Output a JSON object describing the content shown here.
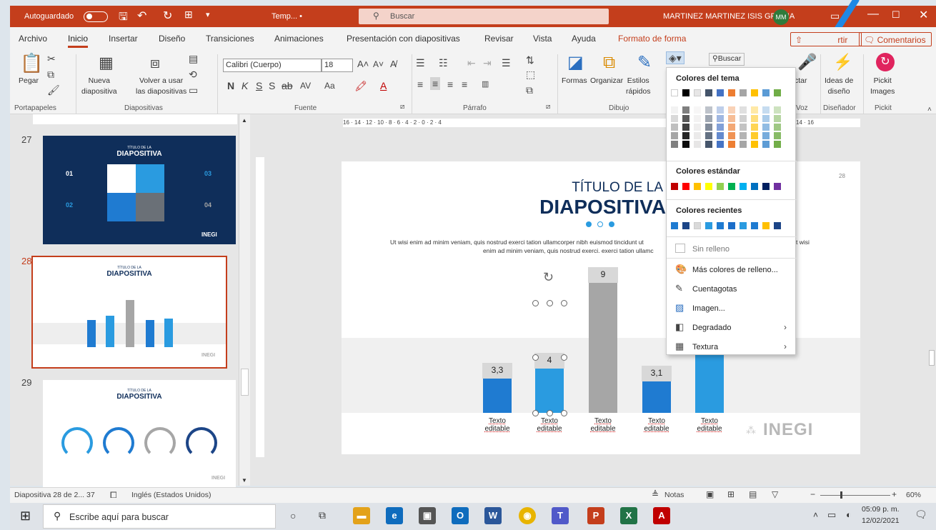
{
  "titlebar": {
    "autosave_label": "Autoguardado",
    "doc": "Temp... •",
    "search": "Buscar",
    "user": "MARTINEZ MARTINEZ ISIS GRECIA",
    "initials": "MM"
  },
  "menu": [
    "Archivo",
    "Inicio",
    "Insertar",
    "Diseño",
    "Transiciones",
    "Animaciones",
    "Presentación con diapositivas",
    "Revisar",
    "Vista",
    "Ayuda",
    "Formato de forma"
  ],
  "menu_right": {
    "comments": "Comentarios",
    "share": "rtir"
  },
  "ribbon": {
    "paste": "Pegar",
    "new_slide": "Nueva\ndiapositiva",
    "reuse": "Volver a usar\nlas diapositivas",
    "font_name": "Calibri (Cuerpo)",
    "font_size": "18",
    "bold": "N",
    "italic": "K",
    "underline": "S",
    "strike": "S",
    "shapes": "Formas",
    "arrange": "Organizar",
    "styles": "Estilos\nrápidos",
    "find": "Buscar",
    "dictate": "ctar",
    "design_ideas": "Ideas de\ndiseño",
    "pickit": "Pickit\nImages",
    "groups": {
      "clipboard": "Portapapeles",
      "slides": "Diapositivas",
      "font": "Fuente",
      "paragraph": "Párrafo",
      "drawing": "Dibujo",
      "voice": "Voz",
      "designer": "Diseñador",
      "pickit": "Pickit"
    }
  },
  "ruler_text": "16 · 14 · 12 · 10 · 8 · 6 · 4 · 2 · 0 · 2 · 4",
  "ruler_right": "14 · 16",
  "thumbnails": [
    {
      "num": "27",
      "title_small": "TÍTULO DE LA",
      "title": "DIAPOSITIVA",
      "n1": "01",
      "n2": "02",
      "n3": "03",
      "n4": "04",
      "logo": "INEGI"
    },
    {
      "num": "28",
      "title_small": "TÍTULO DE LA",
      "title": "DIAPOSITIVA",
      "logo": "INEGI"
    },
    {
      "num": "29",
      "title_small": "TÍTULO DE LA",
      "title": "DIAPOSITIVA",
      "logo": "INEGI"
    }
  ],
  "slide": {
    "page_num": "28",
    "title_small": "TÍTULO DE LA",
    "title": "DIAPOSITIVA",
    "body1": "Ut wisi enim ad minim veniam, quis nostrud exerci tation ullamcorper nibh euismod tincidunt ut",
    "body1b": "t wisi",
    "body2": "enim ad minim veniam, quis nostrud exerci. exerci tation ullamc",
    "logo": "INEGI",
    "bar_label": "Texto\neditable"
  },
  "chart_data": {
    "type": "bar",
    "categories": [
      "Texto editable",
      "Texto editable",
      "Texto editable",
      "Texto editable",
      "Texto editable"
    ],
    "values": [
      3.3,
      4,
      9,
      3.1,
      null
    ],
    "value_labels": [
      "3,3",
      "4",
      "9",
      "3,1",
      ""
    ],
    "colors": [
      "#1f7bd1",
      "#2a9be0",
      "#a6a6a6",
      "#1f7bd1",
      "#2a9be0"
    ]
  },
  "dropdown": {
    "theme_colors": "Colores del tema",
    "standard_colors": "Colores estándar",
    "recent_colors": "Colores recientes",
    "no_fill": "Sin relleno",
    "more_colors": "Más colores de relleno...",
    "eyedropper": "Cuentagotas",
    "image": "Imagen...",
    "gradient": "Degradado",
    "texture": "Textura",
    "theme_row": [
      "#ffffff",
      "#000000",
      "#e7e6e6",
      "#44546a",
      "#4472c4",
      "#ed7d31",
      "#a5a5a5",
      "#ffc000",
      "#5b9bd5",
      "#70ad47"
    ],
    "standard_row": [
      "#c00000",
      "#ff0000",
      "#ffc000",
      "#ffff00",
      "#92d050",
      "#00b050",
      "#00b0f0",
      "#0070c0",
      "#002060",
      "#7030a0"
    ],
    "recent_row": [
      "#1f7bd1",
      "#1c4587",
      "#d9d9d9",
      "#2a9be0",
      "#1f7bd1",
      "#1c6ec9",
      "#2a9be0",
      "#1f7bd1",
      "#ffc000",
      "#1c4587"
    ]
  },
  "status": {
    "slide": "Diapositiva 28 de 2... 37",
    "lang": "Inglés (Estados Unidos)",
    "notes": "Notas",
    "zoom": "60%"
  },
  "taskbar": {
    "search": "Escribe aquí para buscar",
    "time": "05:09 p. m.",
    "date": "12/02/2021"
  }
}
